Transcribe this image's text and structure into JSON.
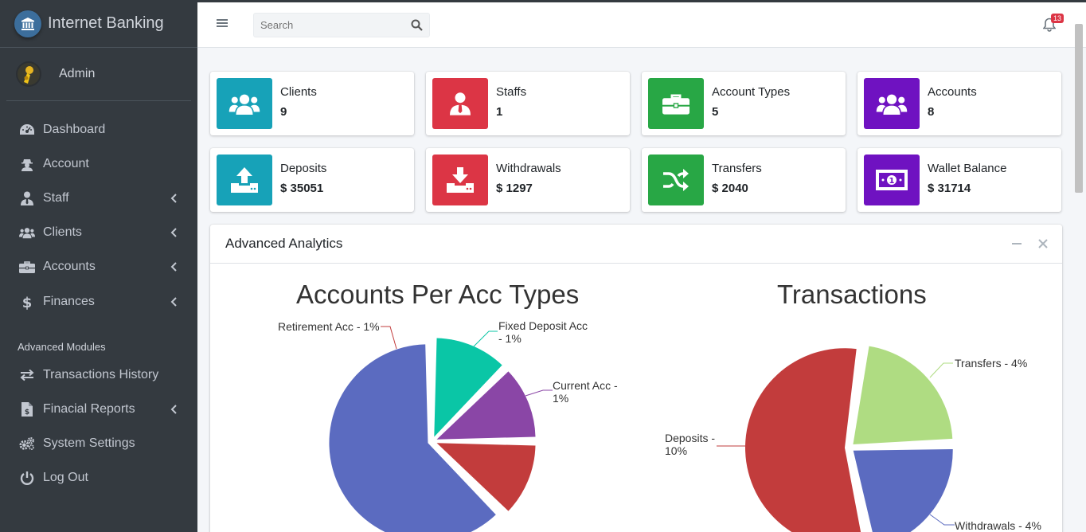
{
  "brand": {
    "title": "Internet Banking"
  },
  "user": {
    "name": "Admin"
  },
  "sidebar": {
    "items": [
      {
        "label": "Dashboard",
        "icon": "tachometer-icon",
        "has_children": false
      },
      {
        "label": "Account",
        "icon": "user-secret-icon",
        "has_children": false
      },
      {
        "label": "Staff",
        "icon": "user-tie-icon",
        "has_children": true
      },
      {
        "label": "Clients",
        "icon": "users-icon",
        "has_children": true
      },
      {
        "label": "Accounts",
        "icon": "briefcase-icon",
        "has_children": true
      },
      {
        "label": "Finances",
        "icon": "dollar-icon",
        "has_children": true
      }
    ],
    "section_header": "Advanced Modules",
    "advanced_items": [
      {
        "label": "Transactions History",
        "icon": "exchange-icon",
        "has_children": false
      },
      {
        "label": "Finacial Reports",
        "icon": "file-invoice-dollar-icon",
        "has_children": true
      },
      {
        "label": "System Settings",
        "icon": "cogs-icon",
        "has_children": false
      },
      {
        "label": "Log Out",
        "icon": "power-off-icon",
        "has_children": false
      }
    ]
  },
  "header": {
    "search_placeholder": "Search",
    "notification_count": "13"
  },
  "info_boxes": [
    {
      "label": "Clients",
      "value": "9",
      "color": "#17a2b8",
      "icon": "users-icon"
    },
    {
      "label": "Staffs",
      "value": "1",
      "color": "#dc3545",
      "icon": "user-tie-icon"
    },
    {
      "label": "Account Types",
      "value": "5",
      "color": "#28a745",
      "icon": "briefcase-icon"
    },
    {
      "label": "Accounts",
      "value": "8",
      "color": "#6f42c1",
      "icon": "users-icon"
    },
    {
      "label": "Deposits",
      "value": "$ 35051",
      "color": "#17a2b8",
      "icon": "upload-icon"
    },
    {
      "label": "Withdrawals",
      "value": "$ 1297",
      "color": "#dc3545",
      "icon": "download-icon"
    },
    {
      "label": "Transfers",
      "value": "$ 2040",
      "color": "#28a745",
      "icon": "random-icon"
    },
    {
      "label": "Wallet Balance",
      "value": "$ 31714",
      "color": "#6f42c1",
      "icon": "money-bill-icon"
    }
  ],
  "analytics": {
    "title": "Advanced Analytics"
  },
  "chart_data": [
    {
      "type": "pie",
      "title": "Accounts Per Acc Types",
      "slices": [
        {
          "label": "Fixed Deposit Acc - 1%",
          "value": 1,
          "color": "#0ac6a6"
        },
        {
          "label": "Current Acc - 1%",
          "value": 1,
          "color": "#8a46a6"
        },
        {
          "label": "Retirement Acc - 1%",
          "value": 1,
          "color": "#c23c3c"
        },
        {
          "label": "",
          "value": 5,
          "color": "#5b6bc0"
        }
      ]
    },
    {
      "type": "pie",
      "title": "Transactions",
      "slices": [
        {
          "label": "Transfers - 4%",
          "value": 4,
          "color": "#afdc82"
        },
        {
          "label": "Withdrawals - 4%",
          "value": 4,
          "color": "#5b6bc0"
        },
        {
          "label": "Deposits - 10%",
          "value": 10,
          "color": "#c23c3c"
        }
      ]
    }
  ]
}
